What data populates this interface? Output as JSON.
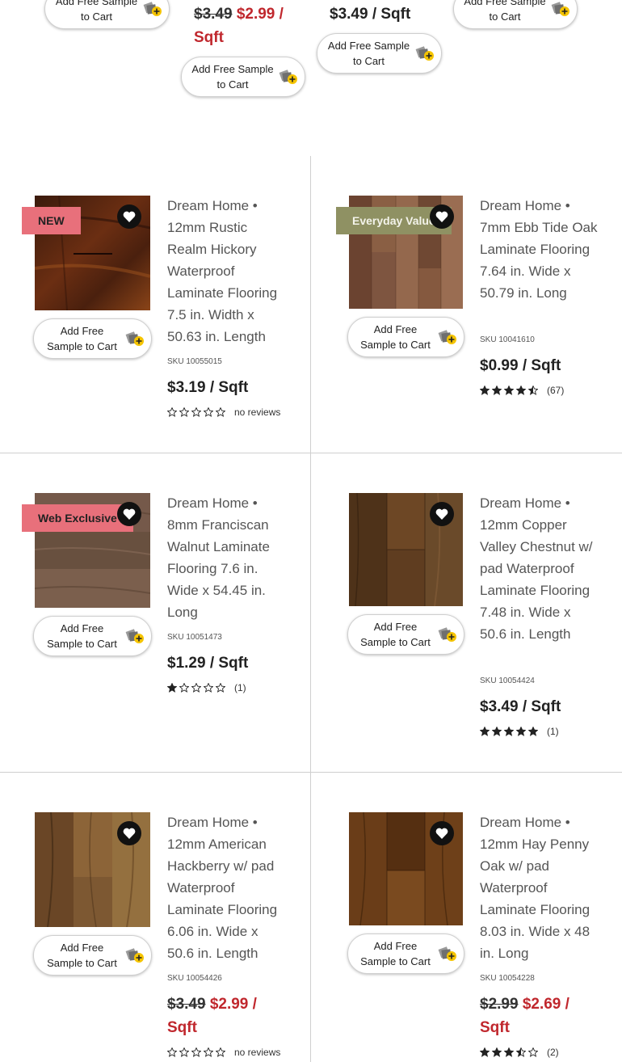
{
  "top_row": {
    "buttons": [
      "Add Free Sample to Cart",
      "Add Free Sample to Cart",
      "Add Free Sample to Cart",
      "Add Free Sample to Cart"
    ],
    "price2_old": "$3.49",
    "price2_new": "$2.99 / Sqft",
    "price3": "$3.49 / Sqft"
  },
  "products": [
    {
      "badge": "NEW",
      "image": "rustic-hickory",
      "title": "Dream Home • 12mm Rustic Realm Hickory Waterproof Laminate Flooring 7.5 in. Width x 50.63 in. Length",
      "sku": "SKU 10055015",
      "price": "$3.19 / Sqft",
      "rating": 0,
      "reviews": "no reviews",
      "button": "Add Free Sample to Cart",
      "heart_icon": "heart-icon"
    },
    {
      "badge": "Everyday Value",
      "image": "ebb-tide-oak",
      "title": "Dream Home • 7mm Ebb Tide Oak Laminate Flooring 7.64 in. Wide x 50.79 in. Long",
      "sku": "SKU 10041610",
      "price": "$0.99 / Sqft",
      "rating": 4.5,
      "reviews": "(67)",
      "button": "Add Free Sample to Cart",
      "heart_icon": "heart-icon"
    },
    {
      "badge": "Web Exclusive",
      "image": "franciscan-walnut",
      "title": "Dream Home • 8mm Franciscan Walnut Laminate Flooring 7.6 in. Wide x 54.45 in. Long",
      "sku": "SKU 10051473",
      "price": "$1.29 / Sqft",
      "rating": 1,
      "reviews": "(1)",
      "button": "Add Free Sample to Cart",
      "heart_icon": "heart-icon"
    },
    {
      "badge": "",
      "image": "copper-valley-chestnut",
      "title": "Dream Home • 12mm Copper Valley Chestnut w/ pad Waterproof Laminate Flooring 7.48 in. Wide x 50.6 in. Length",
      "sku": "SKU 10054424",
      "price": "$3.49 / Sqft",
      "rating": 5,
      "reviews": "(1)",
      "button": "Add Free Sample to Cart",
      "heart_icon": "heart-icon"
    },
    {
      "badge": "",
      "image": "american-hackberry",
      "title": "Dream Home • 12mm American Hackberry w/ pad Waterproof Laminate Flooring 6.06 in. Wide x 50.6 in. Length",
      "sku": "SKU 10054426",
      "price_old": "$3.49",
      "price_new": "$2.99 / Sqft",
      "rating": 0,
      "reviews": "no reviews",
      "button": "Add Free Sample to Cart",
      "heart_icon": "heart-icon"
    },
    {
      "badge": "",
      "image": "hay-penny-oak",
      "title": "Dream Home • 12mm Hay Penny Oak w/ pad Waterproof Laminate Flooring 8.03 in. Wide x 48 in. Long",
      "sku": "SKU 10054228",
      "price_old": "$2.99",
      "price_new": "$2.69 / Sqft",
      "rating": 3.5,
      "reviews": "(2)",
      "button": "Add Free Sample to Cart",
      "heart_icon": "heart-icon"
    }
  ],
  "colors": {
    "sale": "#c0272d",
    "badge_pink": "#e8707b",
    "badge_olive": "#8f9163"
  }
}
